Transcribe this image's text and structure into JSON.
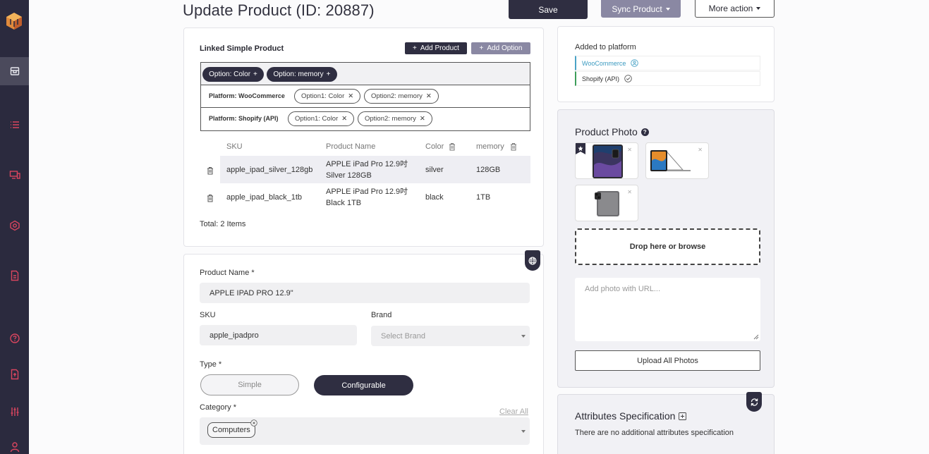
{
  "header": {
    "title": "Update Product (ID: 20887)",
    "save_label": "Save",
    "sync_label": "Sync Product",
    "more_label": "More action"
  },
  "sidebar": {
    "items": [
      {
        "icon": "product-box-icon",
        "active": true
      },
      {
        "icon": "list-icon",
        "active": false
      },
      {
        "icon": "devices-icon",
        "active": false
      },
      {
        "icon": "settings-icon",
        "active": false
      },
      {
        "icon": "document-icon",
        "active": false
      },
      {
        "icon": "help-icon",
        "active": false
      },
      {
        "icon": "file-icon",
        "active": false
      },
      {
        "icon": "sliders-icon",
        "active": false
      },
      {
        "icon": "user-icon",
        "active": false
      }
    ]
  },
  "linked": {
    "title": "Linked Simple Product",
    "add_product_label": "Add Product",
    "add_option_label": "Add Option",
    "options": [
      "Option: Color",
      "Option: memory"
    ],
    "platforms": [
      {
        "label": "Platform: WooCommerce",
        "chips": [
          "Option1: Color",
          "Option2: memory"
        ]
      },
      {
        "label": "Platform: Shopify (API)",
        "chips": [
          "Option1: Color",
          "Option2: memory"
        ]
      }
    ],
    "columns": [
      "SKU",
      "Product Name",
      "Color",
      "memory"
    ],
    "rows": [
      {
        "sku": "apple_ipad_silver_128gb",
        "name_line1": "APPLE iPad Pro 12.9吋",
        "name_line2": "Silver 128GB",
        "color": "silver",
        "memory": "128GB"
      },
      {
        "sku": "apple_ipad_black_1tb",
        "name_line1": "APPLE iPad Pro 12.9吋",
        "name_line2": "Black 1TB",
        "color": "black",
        "memory": "1TB"
      }
    ],
    "total": "Total: 2 Items"
  },
  "form": {
    "product_name_label": "Product Name *",
    "product_name_value": "APPLE IPAD PRO 12.9\"",
    "sku_label": "SKU",
    "sku_value": "apple_ipadpro",
    "brand_label": "Brand",
    "brand_placeholder": "Select Brand",
    "type_label": "Type *",
    "type_simple": "Simple",
    "type_configurable": "Configurable",
    "category_label": "Category *",
    "clear_all": "Clear All",
    "category_chip": "Computers"
  },
  "platform": {
    "title": "Added to platform",
    "items": [
      {
        "name": "WooCommerce",
        "color": "#3b9ac0"
      },
      {
        "name": "Shopify (API)",
        "color": "#333333"
      }
    ]
  },
  "photo": {
    "title": "Product Photo",
    "drop_label": "Drop here or browse",
    "url_placeholder": "Add photo with URL...",
    "upload_label": "Upload All Photos"
  },
  "attributes": {
    "title": "Attributes Specification",
    "subtitle": "There are no additional attributes specification"
  },
  "colors": {
    "sidebar": "#2b2a3e",
    "primary": "#2f2e41",
    "secondary": "#8a88a3",
    "woocommerce": "#4aa3c6",
    "shopify": "#3d9d5a"
  }
}
